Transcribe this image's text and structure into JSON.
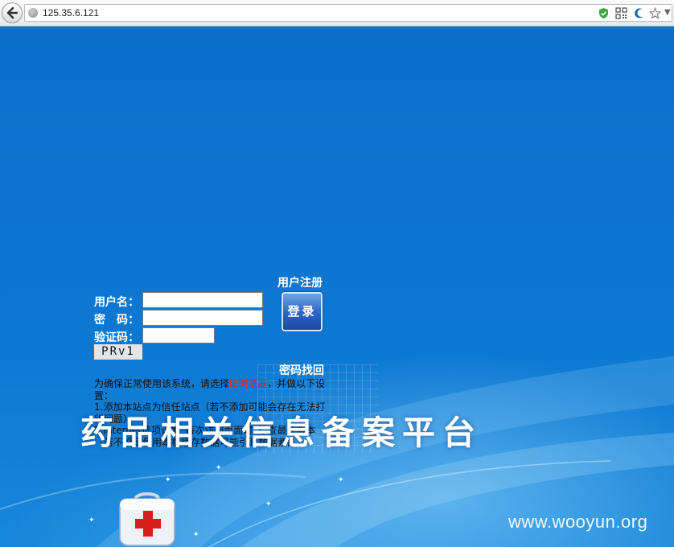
{
  "browser": {
    "url": "125.35.6.121",
    "toolbar_icons": [
      "shield-icon",
      "qr-code-icon",
      "moon-icon",
      "star-icon",
      "dropdown-icon"
    ]
  },
  "login": {
    "register_link": "用户注册",
    "username_label": "用户名：",
    "password_label": "密　码：",
    "captcha_label": "验证码：",
    "username_value": "",
    "password_value": "",
    "captcha_value": "",
    "captcha_image_text": "PRv1",
    "login_button": "登录",
    "forgot_password_link": "密码找回"
  },
  "notice": {
    "intro_before": "为确保正常使用该系统，请选择",
    "browser_link": "IE浏览器",
    "intro_after": "，并做以下设置：",
    "step1": "1.添加本站点为信任站点（若不添加可能会存在无法打印问题）",
    "step2": "2.Internet选项设置“每次访问页面时”检查最新版本（若不设定使用本机缓存数据可能引起数据紊乱）"
  },
  "title": "药品相关信息备案平台",
  "watermark": "www.wooyun.org",
  "colors": {
    "page_background": "#0b6fca",
    "link_red": "#e0201c",
    "button_blue": "#2d62c1"
  }
}
